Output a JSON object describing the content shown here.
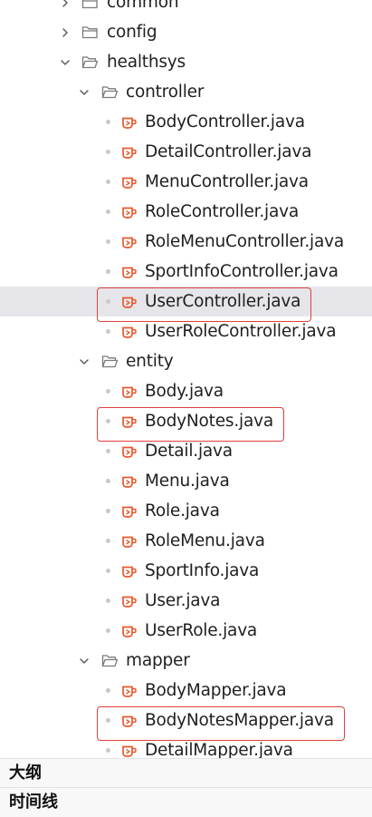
{
  "tree": [
    {
      "type": "folder",
      "level": 0,
      "label": "common",
      "expanded": false
    },
    {
      "type": "folder",
      "level": 0,
      "label": "config",
      "expanded": false
    },
    {
      "type": "folder",
      "level": 0,
      "label": "healthsys",
      "expanded": true
    },
    {
      "type": "folder",
      "level": 1,
      "label": "controller",
      "expanded": true
    },
    {
      "type": "file",
      "level": 2,
      "label": "BodyController.java"
    },
    {
      "type": "file",
      "level": 2,
      "label": "DetailController.java"
    },
    {
      "type": "file",
      "level": 2,
      "label": "MenuController.java"
    },
    {
      "type": "file",
      "level": 2,
      "label": "RoleController.java"
    },
    {
      "type": "file",
      "level": 2,
      "label": "RoleMenuController.java"
    },
    {
      "type": "file",
      "level": 2,
      "label": "SportInfoController.java"
    },
    {
      "type": "file",
      "level": 2,
      "label": "UserController.java",
      "selected": true,
      "highlighted": true
    },
    {
      "type": "file",
      "level": 2,
      "label": "UserRoleController.java"
    },
    {
      "type": "folder",
      "level": 1,
      "label": "entity",
      "expanded": true
    },
    {
      "type": "file",
      "level": 2,
      "label": "Body.java"
    },
    {
      "type": "file",
      "level": 2,
      "label": "BodyNotes.java",
      "highlighted": true
    },
    {
      "type": "file",
      "level": 2,
      "label": "Detail.java"
    },
    {
      "type": "file",
      "level": 2,
      "label": "Menu.java"
    },
    {
      "type": "file",
      "level": 2,
      "label": "Role.java"
    },
    {
      "type": "file",
      "level": 2,
      "label": "RoleMenu.java"
    },
    {
      "type": "file",
      "level": 2,
      "label": "SportInfo.java"
    },
    {
      "type": "file",
      "level": 2,
      "label": "User.java"
    },
    {
      "type": "file",
      "level": 2,
      "label": "UserRole.java"
    },
    {
      "type": "folder",
      "level": 1,
      "label": "mapper",
      "expanded": true
    },
    {
      "type": "file",
      "level": 2,
      "label": "BodyMapper.java"
    },
    {
      "type": "file",
      "level": 2,
      "label": "BodyNotesMapper.java",
      "highlighted": true
    },
    {
      "type": "file",
      "level": 2,
      "label": "DetailMapper.java"
    }
  ],
  "sections": {
    "outline": "大纲",
    "timeline": "时间线"
  },
  "colors": {
    "java_icon": "#e8582c",
    "folder_icon": "#7a7a7a",
    "highlight_border": "#e0403a",
    "selected_row": "#e6e6ea"
  },
  "icons": {
    "folder_closed": "folder-icon",
    "folder_open": "folder-open-icon",
    "java_file": "java-file-icon",
    "collapsed": "chevron-right-icon",
    "expanded": "chevron-down-icon"
  }
}
